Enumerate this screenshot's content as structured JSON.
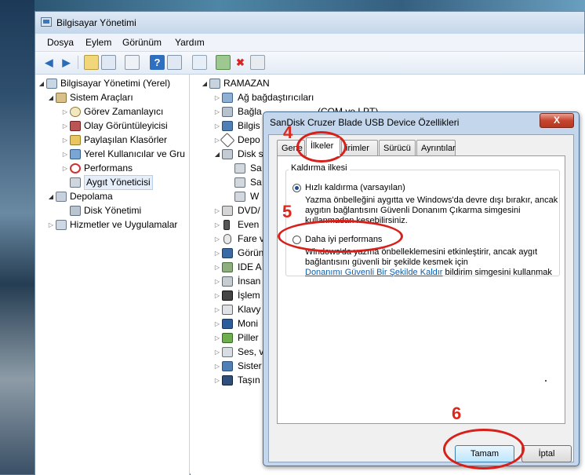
{
  "window": {
    "title": "Bilgisayar Yönetimi"
  },
  "menu": [
    "Dosya",
    "Eylem",
    "Görünüm",
    "Yardım"
  ],
  "left_tree": [
    {
      "label": "Bilgisayar Yönetimi (Yerel)",
      "icon": "computer-management-icon"
    },
    {
      "label": "Sistem Araçları",
      "icon": "tools-icon"
    },
    {
      "label": "Görev Zamanlayıcı",
      "icon": "clock-icon"
    },
    {
      "label": "Olay Görüntüleyicisi",
      "icon": "event-viewer-icon"
    },
    {
      "label": "Paylaşılan Klasörler",
      "icon": "shared-folder-icon"
    },
    {
      "label": "Yerel Kullanıcılar ve Gru",
      "icon": "users-icon"
    },
    {
      "label": "Performans",
      "icon": "performance-icon"
    },
    {
      "label": "Aygıt Yöneticisi",
      "icon": "device-manager-icon"
    },
    {
      "label": "Depolama",
      "icon": "storage-icon"
    },
    {
      "label": "Disk Yönetimi",
      "icon": "disk-icon"
    },
    {
      "label": "Hizmetler ve Uygulamalar",
      "icon": "services-icon"
    }
  ],
  "right_tree": {
    "root": "RAMAZAN",
    "items": [
      "Ağ bağdaştırıcıları",
      "Bağla",
      "Bilgis",
      "Depo",
      "Disk s",
      "Sa",
      "Sa",
      "W",
      "DVD/",
      "Even",
      "Fare v",
      "Görün",
      "IDE A",
      "İnsan",
      "İşlem",
      "Klavy",
      "Moni",
      "Piller",
      "Ses, v",
      "Sister",
      "Taşın"
    ],
    "partial_hidden_text": "(COM ve LPT)"
  },
  "dialog": {
    "title": "SanDisk Cruzer Blade USB Device Özellikleri",
    "close": "X",
    "tabs": [
      "Genel",
      "İlkeler",
      "Birimler",
      "Sürücü",
      "Ayrıntılar"
    ],
    "tab_visible": [
      "Gene",
      "İlkeler",
      "irimler",
      "Sürücü",
      "Ayrıntılar"
    ],
    "group_title": "Kaldırma ilkesi",
    "option1_label": "Hızlı kaldırma (varsayılan)",
    "option1_desc1": "Yazma önbelleğini aygıtta ve Windows'da devre dışı bırakır, ancak",
    "option1_desc2": "aygıtın bağlantısını Güvenli Donanım Çıkarma simgesini",
    "option1_desc3": "kullanmadan kesebilirsiniz.",
    "option2_label": "Daha iyi performans",
    "option2_desc1": "Windows'da yazma önbelleklemesini etkinleştirir, ancak aygıt",
    "option2_desc2": "bağlantısını güvenli bir şekilde kesmek için",
    "option2_link": "Donanımı Güvenli Bir Şekilde Kaldır",
    "option2_after": "bildirim simgesini kullanmak",
    "ok": "Tamam",
    "cancel": "İptal"
  },
  "annotations": {
    "n4": "4",
    "n5": "5",
    "n6": "6",
    "color": "#e0261b"
  }
}
